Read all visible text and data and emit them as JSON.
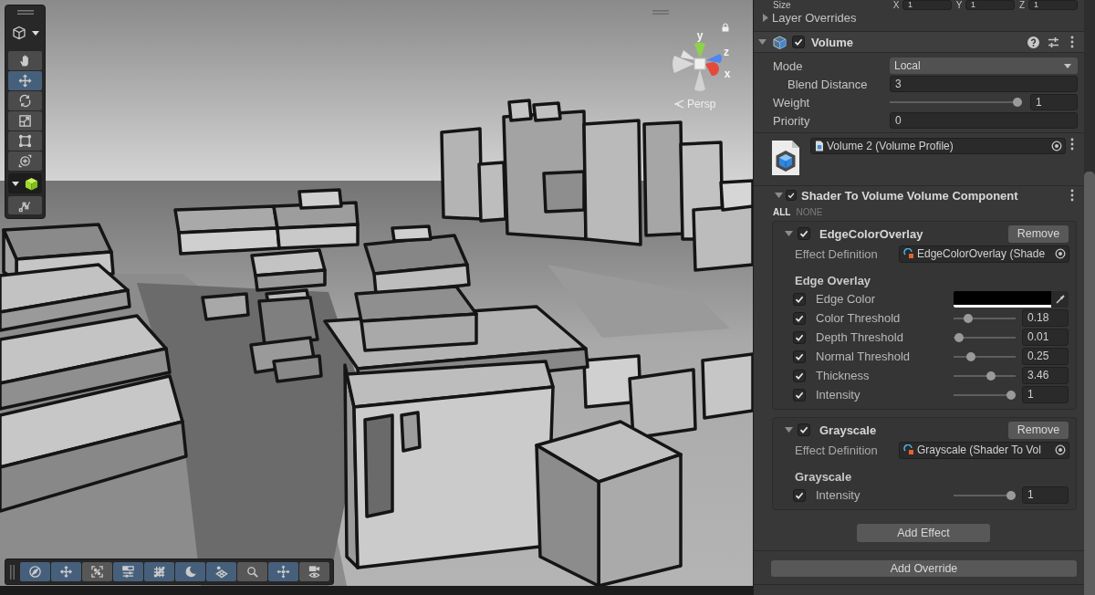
{
  "scene_view": {
    "tools": [
      {
        "kind": "hand",
        "selected": false
      },
      {
        "kind": "move",
        "selected": true
      },
      {
        "kind": "rotate",
        "selected": false
      },
      {
        "kind": "scale",
        "selected": false
      },
      {
        "kind": "rect",
        "selected": false
      },
      {
        "kind": "transform",
        "selected": false
      }
    ],
    "overlay_tools": [
      {
        "kind": "compass",
        "on": true
      },
      {
        "kind": "arrows",
        "on": true
      },
      {
        "kind": "brackets",
        "on": false
      },
      {
        "kind": "sliders",
        "on": true
      },
      {
        "kind": "grid",
        "on": true
      },
      {
        "kind": "crescent",
        "on": true
      },
      {
        "kind": "diamond",
        "on": true
      },
      {
        "kind": "magnifier",
        "on": false
      },
      {
        "kind": "cross",
        "on": true
      },
      {
        "kind": "camera",
        "on": false
      }
    ],
    "gizmo": {
      "axes": [
        {
          "label": "y",
          "color": "#8ed24a"
        },
        {
          "label": "z",
          "color": "#4f86f0"
        },
        {
          "label": "x",
          "color": "#e24b3b"
        }
      ],
      "projection": "Persp"
    }
  },
  "inspector": {
    "size": {
      "label": "Size",
      "fields": [
        {
          "axis": "X",
          "value": "1"
        },
        {
          "axis": "Y",
          "value": "1"
        },
        {
          "axis": "Z",
          "value": "1"
        }
      ]
    },
    "layer_overrides": {
      "label": "Layer Overrides",
      "expanded": false
    },
    "volume": {
      "title": "Volume",
      "expanded": true,
      "enabled": true,
      "properties": [
        {
          "kind": "dropdown",
          "label": "Mode",
          "value": "Local",
          "children": [
            {
              "kind": "number",
              "label": "Blend Distance",
              "value": "3"
            }
          ]
        },
        {
          "kind": "slider",
          "label": "Weight",
          "level": 1,
          "value": "1"
        },
        {
          "kind": "number",
          "label": "Priority",
          "value": "0"
        }
      ],
      "profile": "Volume 2 (Volume Profile)"
    },
    "component": {
      "title": "Shader To Volume Volume Component",
      "expanded": true,
      "enabled": true,
      "select_all": "ALL",
      "select_none": "NONE",
      "effects": [
        {
          "title": "EdgeColorOverlay",
          "expanded": true,
          "enabled": true,
          "remove": "Remove",
          "definition_label": "Effect Definition",
          "definition": "EdgeColorOverlay (Shade",
          "section": "Edge Overlay",
          "properties": [
            {
              "kind": "color",
              "label": "Edge Color",
              "checked": true,
              "color": "#000000"
            },
            {
              "kind": "slider",
              "label": "Color Threshold",
              "checked": true,
              "level": 0.19,
              "value": "0.18"
            },
            {
              "kind": "slider",
              "label": "Depth Threshold",
              "checked": true,
              "level": 0.01,
              "value": "0.01"
            },
            {
              "kind": "slider",
              "label": "Normal Threshold",
              "checked": true,
              "level": 0.24,
              "value": "0.25"
            },
            {
              "kind": "slider",
              "label": "Thickness",
              "checked": true,
              "level": 0.62,
              "value": "3.46"
            },
            {
              "kind": "slider",
              "label": "Intensity",
              "checked": true,
              "level": 1,
              "value": "1"
            }
          ]
        },
        {
          "title": "Grayscale",
          "expanded": true,
          "enabled": true,
          "remove": "Remove",
          "definition_label": "Effect Definition",
          "definition": "Grayscale (Shader To Vol",
          "section": "Grayscale",
          "properties": [
            {
              "kind": "slider",
              "label": "Intensity",
              "checked": true,
              "level": 1,
              "value": "1"
            }
          ]
        }
      ],
      "add_effect": "Add Effect"
    },
    "add_override": "Add Override"
  }
}
